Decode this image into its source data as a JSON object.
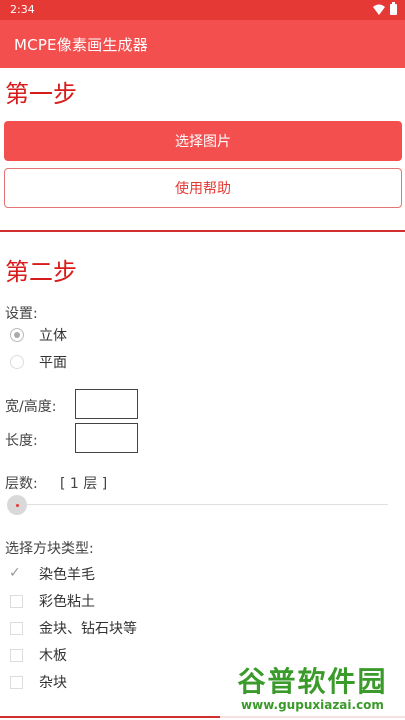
{
  "status_bar": {
    "time": "2:34"
  },
  "app_bar": {
    "title": "MCPE像素画生成器"
  },
  "step1": {
    "title": "第一步",
    "select_image_label": "选择图片",
    "help_label": "使用帮助"
  },
  "step2": {
    "title": "第二步",
    "settings_label": "设置:",
    "options": [
      "立体",
      "平面"
    ],
    "selected_option": "立体",
    "width_height_label": "宽/高度:",
    "length_label": "长度:",
    "layers_label": "层数:",
    "layers_value": "[ 1 层 ]",
    "layers_slider_value": 1,
    "block_type_label": "选择方块类型:",
    "block_types": [
      {
        "label": "染色羊毛",
        "checked": true
      },
      {
        "label": "彩色粘土",
        "checked": false
      },
      {
        "label": "金块、钻石块等",
        "checked": false
      },
      {
        "label": "木板",
        "checked": false
      },
      {
        "label": "杂块",
        "checked": false
      }
    ]
  },
  "watermark": {
    "main": "谷普软件园",
    "sub": "www.gupuxiazai.com"
  },
  "colors": {
    "primary": "#f44f4f",
    "accent": "#d81b1b"
  }
}
